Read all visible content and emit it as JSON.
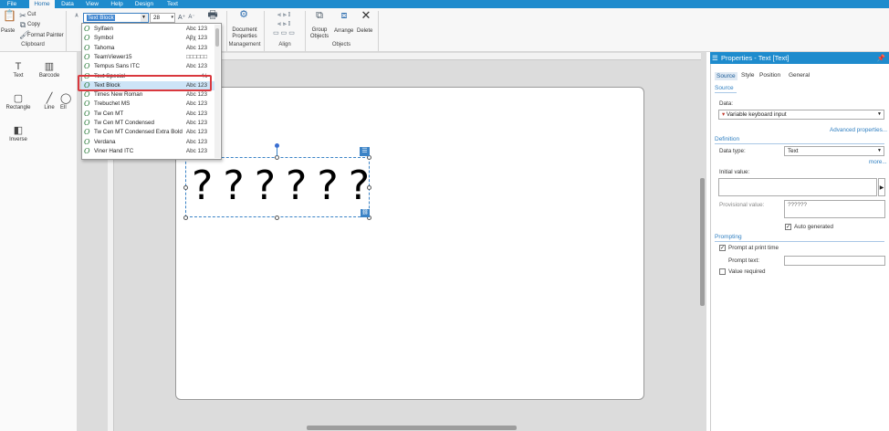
{
  "menu": {
    "tabs": [
      "File",
      "Home",
      "Data",
      "View",
      "Help",
      "Design",
      "Text"
    ],
    "active": "Home"
  },
  "ribbon": {
    "paste": "Paste",
    "cut": "Cut",
    "copy": "Copy",
    "format_painter": "Format Painter",
    "clipboard": "Clipboard",
    "font_name": "Text Block",
    "font_size": "28",
    "document_properties": "Document Properties",
    "management": "Management",
    "align": "Align",
    "group_objects": "Group Objects",
    "arrange": "Arrange",
    "delete": "Delete",
    "objects": "Objects"
  },
  "toolbox": {
    "text": "Text",
    "barcode": "Barcode",
    "rectangle": "Rectangle",
    "line": "Line",
    "inverse": "Inverse",
    "ellipse_partial": "Ell"
  },
  "font_list": [
    {
      "name": "Sylfaen",
      "preview": "Abc 123"
    },
    {
      "name": "Symbol",
      "preview": "Αβχ 123"
    },
    {
      "name": "Tahoma",
      "preview": "Abc 123"
    },
    {
      "name": "TeamViewer15",
      "preview": "□□□□□□"
    },
    {
      "name": "Tempus Sans ITC",
      "preview": "Abc 123"
    },
    {
      "name": "Text Special",
      "preview": "⅍"
    },
    {
      "name": "Text Block",
      "preview": "Abc 123"
    },
    {
      "name": "Times New Roman",
      "preview": "Abc 123"
    },
    {
      "name": "Trebuchet MS",
      "preview": "Abc 123"
    },
    {
      "name": "Tw Cen MT",
      "preview": "Abc 123"
    },
    {
      "name": "Tw Cen MT Condensed",
      "preview": "Abc 123"
    },
    {
      "name": "Tw Cen MT Condensed Extra Bold",
      "preview": "Abc 123"
    },
    {
      "name": "Verdana",
      "preview": "Abc 123"
    },
    {
      "name": "Viner Hand ITC",
      "preview": "Abc 123"
    }
  ],
  "canvas": {
    "object_text": "??????"
  },
  "properties": {
    "title": "Properties - Text [Text]",
    "tabs": [
      "Source",
      "Style",
      "Position",
      "General"
    ],
    "source_section": "Source",
    "data_label": "Data:",
    "data_value": "Variable keyboard input",
    "advanced_link": "Advanced properties...",
    "definition_section": "Definition",
    "data_type_label": "Data type:",
    "data_type_value": "Text",
    "more_link": "more...",
    "initial_value_label": "Initial value:",
    "provisional_label": "Provisional value:",
    "provisional_value": "??????",
    "auto_generated": "Auto generated",
    "prompting_section": "Prompting",
    "prompt_at_print": "Prompt at print time",
    "prompt_text_label": "Prompt text:",
    "value_required": "Value required"
  }
}
